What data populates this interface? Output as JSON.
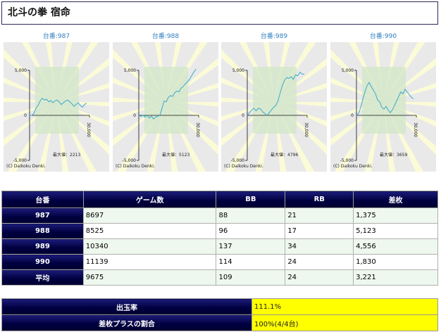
{
  "page": {
    "title": "北斗の拳 宿命"
  },
  "graphs": [
    {
      "label": "台番:987",
      "ytop": "5,000",
      "ymid": "0",
      "ybot": "-5,000",
      "xlabel": "30,000",
      "max_label": "最大値：2213",
      "copyright": "(C) Daikoku Denki.",
      "series": [
        0,
        0,
        200,
        800,
        1100,
        1600,
        1900,
        1700,
        1800,
        1500,
        1650,
        1400,
        1600,
        1700,
        1500,
        1200,
        1400,
        1600,
        1700,
        1500,
        1300,
        1000,
        1200,
        1400,
        1100,
        900,
        1200,
        1375
      ]
    },
    {
      "label": "台番:988",
      "ytop": "5,000",
      "ymid": "0",
      "ybot": "-5,000",
      "xlabel": "30,000",
      "max_label": "最大値：5123",
      "copyright": "(C) Daikoku Denki.",
      "series": [
        0,
        -100,
        0,
        -200,
        0,
        -300,
        -100,
        -400,
        -200,
        -100,
        0,
        800,
        1600,
        1500,
        2000,
        2200,
        2100,
        2500,
        2700,
        2600,
        3000,
        3200,
        3500,
        3700,
        4000,
        4400,
        4800,
        5123
      ]
    },
    {
      "label": "台番:989",
      "ytop": "5,000",
      "ymid": "0",
      "ybot": "-5,000",
      "xlabel": "30,000",
      "max_label": "最大値：4796",
      "copyright": "(C) Daikoku Denki.",
      "series": [
        0,
        300,
        600,
        800,
        500,
        800,
        700,
        400,
        200,
        0,
        300,
        600,
        900,
        1100,
        1600,
        2500,
        3300,
        3900,
        4200,
        4100,
        4300,
        4000,
        4500,
        4400,
        4796,
        4600,
        4556
      ]
    },
    {
      "label": "台番:990",
      "ytop": "5,000",
      "ymid": "0",
      "ybot": "-5,000",
      "xlabel": "30,000",
      "max_label": "最大値：3659",
      "copyright": "(C) Daikoku Denki.",
      "series": [
        0,
        200,
        900,
        1800,
        2600,
        3300,
        3659,
        3200,
        2800,
        2400,
        1700,
        1500,
        900,
        700,
        1000,
        600,
        300,
        600,
        1100,
        1600,
        2100,
        2600,
        2400,
        2900,
        2600,
        2300,
        2000,
        1830
      ]
    }
  ],
  "table": {
    "headers": [
      "台番",
      "ゲーム数",
      "BB",
      "RB",
      "差枚"
    ],
    "rows": [
      [
        "987",
        "8697",
        "88",
        "21",
        "1,375"
      ],
      [
        "988",
        "8525",
        "96",
        "17",
        "5,123"
      ],
      [
        "989",
        "10340",
        "137",
        "34",
        "4,556"
      ],
      [
        "990",
        "11139",
        "114",
        "24",
        "1,830"
      ],
      [
        "平均",
        "9675",
        "109",
        "24",
        "3,221"
      ]
    ]
  },
  "summary": [
    {
      "label": "出玉率",
      "value": "111.1%"
    },
    {
      "label": "差枚プラスの割合",
      "value": "100%(4/4台)"
    }
  ],
  "colors": {
    "header_navy": "#000040",
    "highlight_yellow": "#ffff00",
    "graph_line": "#3aaacb",
    "label_blue": "#2f7fbf"
  }
}
